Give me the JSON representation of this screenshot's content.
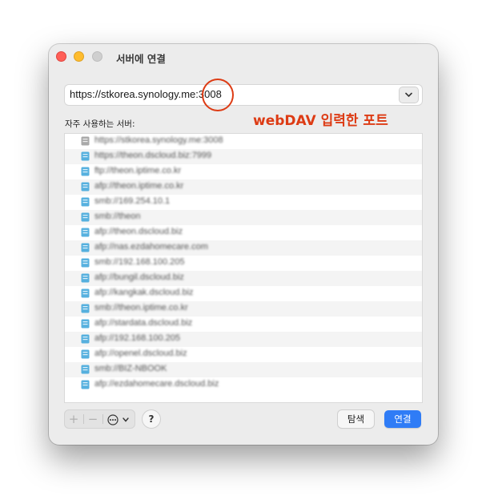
{
  "window": {
    "title": "서버에 연결"
  },
  "url_field": {
    "value_prefix": "https://stkorea.synology.me:",
    "value_port": "3008"
  },
  "annotation": {
    "text": "webDAV 입력한 포트",
    "color": "#dd3b14"
  },
  "favorites": {
    "label": "자주 사용하는 서버:",
    "items": [
      "https://stkorea.synology.me:3008",
      "https://theon.dscloud.biz:7999",
      "ftp://theon.iptime.co.kr",
      "afp://theon.iptime.co.kr",
      "smb://169.254.10.1",
      "smb://theon",
      "afp://theon.dscloud.biz",
      "afp://nas.ezdahomecare.com",
      "smb://192.168.100.205",
      "afp://bungil.dscloud.biz",
      "afp://kangkak.dscloud.biz",
      "smb://theon.iptime.co.kr",
      "afp://stardata.dscloud.biz",
      "afp://192.168.100.205",
      "afp://openel.dscloud.biz",
      "smb://BIZ-NBOOK",
      "afp://ezdahomecare.dscloud.biz"
    ]
  },
  "toolbar": {
    "add": "+",
    "remove": "−",
    "help": "?",
    "browse": "탐색",
    "connect": "연결"
  },
  "colors": {
    "accent": "#2f7cf6",
    "close": "#ff5f57",
    "minimize": "#febc2e"
  }
}
